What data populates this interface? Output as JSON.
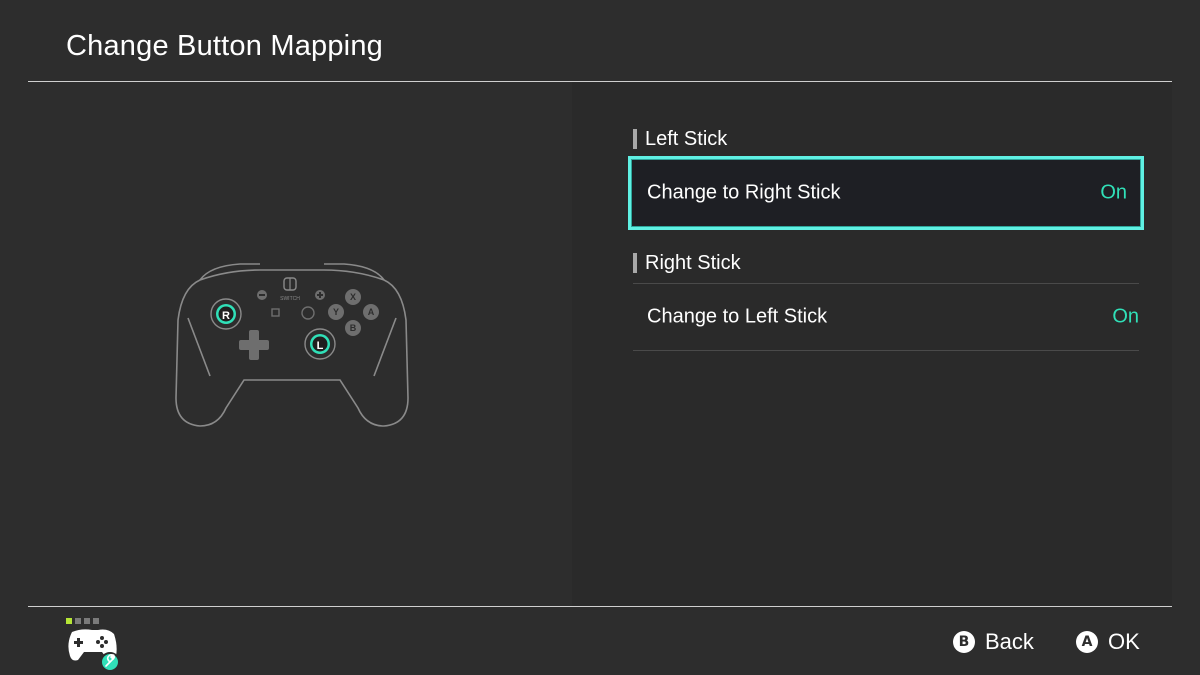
{
  "header": {
    "title": "Change Button Mapping"
  },
  "illustration": {
    "icon": "pro-controller-icon",
    "highlight_color": "#30e0b8",
    "stick_labels": {
      "right": "R",
      "left": "L"
    },
    "face_buttons": [
      "X",
      "Y",
      "A",
      "B"
    ],
    "brand_text": "SWITCH"
  },
  "settings": {
    "sections": [
      {
        "title": "Left Stick",
        "option": {
          "label": "Change to Right Stick",
          "value": "On",
          "selected": true
        }
      },
      {
        "title": "Right Stick",
        "option": {
          "label": "Change to Left Stick",
          "value": "On",
          "selected": false
        }
      }
    ]
  },
  "footer": {
    "controller_icon": "controller-settings-icon",
    "page_indicator": {
      "count": 4,
      "active": 1
    },
    "back": {
      "glyph": "B",
      "label": "Back"
    },
    "ok": {
      "glyph": "A",
      "label": "OK"
    }
  },
  "colors": {
    "background": "#2d2d2d",
    "accent_selection": "#5ff0e3",
    "value_on": "#30e0b8",
    "page_indicator_active": "#b6e636"
  }
}
